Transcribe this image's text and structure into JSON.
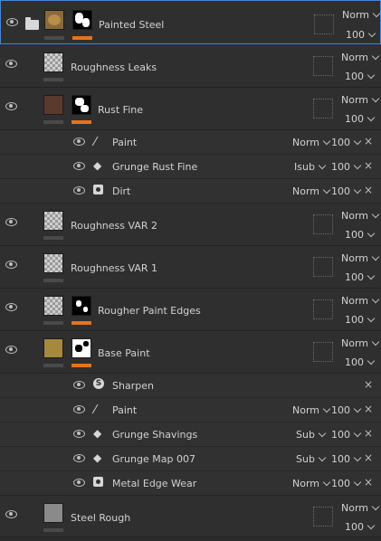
{
  "colors": {
    "accent_bar": "#e3741e",
    "dark_bar": "#4a4a4a",
    "selection": "#4a86d4"
  },
  "layers": [
    {
      "name": "Painted Steel",
      "blend": "Norm",
      "opacity": "100",
      "selected": true,
      "folder": true
    },
    {
      "name": "Roughness Leaks",
      "blend": "Norm",
      "opacity": "100"
    },
    {
      "name": "Rust Fine",
      "blend": "Norm",
      "opacity": "100"
    },
    {
      "name": "Roughness VAR 2",
      "blend": "Norm",
      "opacity": "100"
    },
    {
      "name": "Roughness VAR 1",
      "blend": "Norm",
      "opacity": "100"
    },
    {
      "name": "Rougher Paint Edges",
      "blend": "Norm",
      "opacity": "100"
    },
    {
      "name": "Base Paint",
      "blend": "Norm",
      "opacity": "100"
    },
    {
      "name": "Steel Rough",
      "blend": "Norm",
      "opacity": "100"
    }
  ],
  "rust_effects": [
    {
      "name": "Paint",
      "icon": "brush-icon",
      "blend": "Norm",
      "opacity": "100"
    },
    {
      "name": "Grunge Rust Fine",
      "icon": "fill-icon",
      "blend": "Isub",
      "opacity": "100"
    },
    {
      "name": "Dirt",
      "icon": "generator-icon",
      "blend": "Norm",
      "opacity": "100"
    }
  ],
  "base_effects": [
    {
      "name": "Sharpen",
      "icon": "filter-icon",
      "blend": "",
      "opacity": ""
    },
    {
      "name": "Paint",
      "icon": "brush-icon",
      "blend": "Norm",
      "opacity": "100"
    },
    {
      "name": "Grunge Shavings",
      "icon": "fill-icon",
      "blend": "Sub",
      "opacity": "100"
    },
    {
      "name": "Grunge Map 007",
      "icon": "fill-icon",
      "blend": "Sub",
      "opacity": "100"
    },
    {
      "name": "Metal Edge Wear",
      "icon": "generator-icon",
      "blend": "Norm",
      "opacity": "100"
    }
  ]
}
